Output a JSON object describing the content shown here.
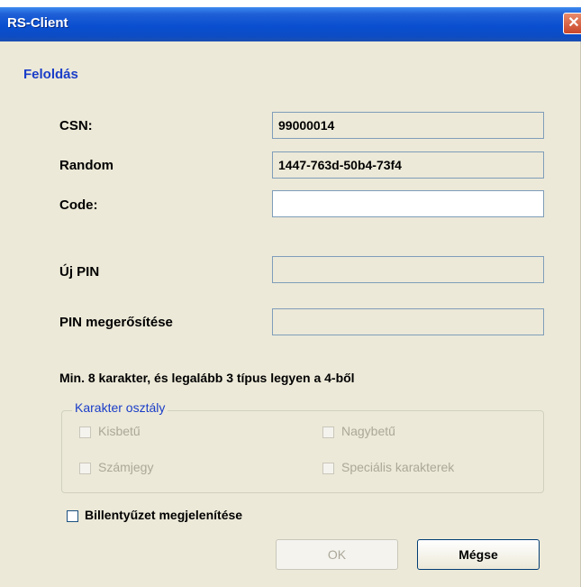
{
  "window": {
    "title": "RS-Client",
    "close_glyph": "✕"
  },
  "section": {
    "title": "Feloldás"
  },
  "fields": {
    "csn": {
      "label": "CSN:",
      "value": "99000014"
    },
    "random": {
      "label": "Random",
      "value": "1447-763d-50b4-73f4"
    },
    "code": {
      "label": "Code:",
      "value": "",
      "placeholder": ""
    },
    "new_pin": {
      "label": "Új PIN",
      "value": ""
    },
    "confirm_pin": {
      "label": "PIN megerősítése",
      "value": ""
    }
  },
  "hint": "Min. 8 karakter, és legalább 3 típus legyen a 4-ből",
  "char_class": {
    "legend": "Karakter osztály",
    "options": [
      {
        "label": "Kisbetű",
        "checked": false,
        "enabled": false
      },
      {
        "label": "Nagybetű",
        "checked": false,
        "enabled": false
      },
      {
        "label": "Számjegy",
        "checked": false,
        "enabled": false
      },
      {
        "label": "Speciális karakterek",
        "checked": false,
        "enabled": false
      }
    ]
  },
  "keyboard_toggle": {
    "label": "Billentyűzet megjelenítése",
    "checked": false
  },
  "buttons": {
    "ok": "OK",
    "cancel": "Mégse"
  },
  "colors": {
    "titlebar": "#0a4fd0",
    "section_title": "#1a3dc8",
    "window_bg": "#ece9d8"
  }
}
